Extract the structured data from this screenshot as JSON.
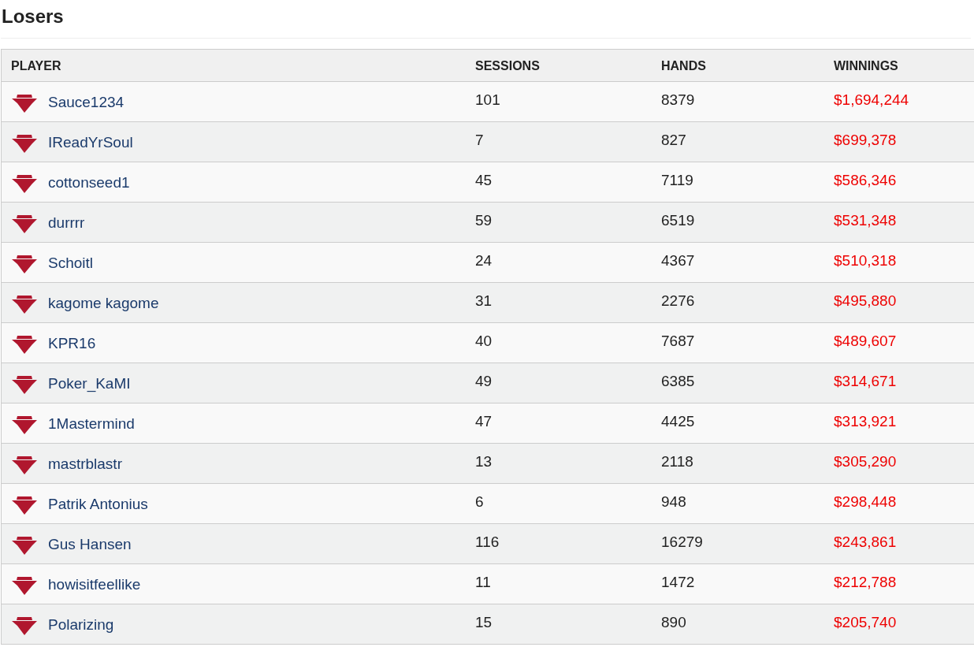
{
  "title": "Losers",
  "table": {
    "columns": [
      "PLAYER",
      "SESSIONS",
      "HANDS",
      "WINNINGS"
    ],
    "rows": [
      {
        "player": "Sauce1234",
        "sessions": "101",
        "hands": "8379",
        "winnings": "$1,694,244"
      },
      {
        "player": "IReadYrSoul",
        "sessions": "7",
        "hands": "827",
        "winnings": "$699,378"
      },
      {
        "player": "cottonseed1",
        "sessions": "45",
        "hands": "7119",
        "winnings": "$586,346"
      },
      {
        "player": "durrrr",
        "sessions": "59",
        "hands": "6519",
        "winnings": "$531,348"
      },
      {
        "player": "Schoitl",
        "sessions": "24",
        "hands": "4367",
        "winnings": "$510,318"
      },
      {
        "player": "kagome kagome",
        "sessions": "31",
        "hands": "2276",
        "winnings": "$495,880"
      },
      {
        "player": "KPR16",
        "sessions": "40",
        "hands": "7687",
        "winnings": "$489,607"
      },
      {
        "player": "Poker_KaMI",
        "sessions": "49",
        "hands": "6385",
        "winnings": "$314,671"
      },
      {
        "player": "1Mastermind",
        "sessions": "47",
        "hands": "4425",
        "winnings": "$313,921"
      },
      {
        "player": "mastrblastr",
        "sessions": "13",
        "hands": "2118",
        "winnings": "$305,290"
      },
      {
        "player": "Patrik Antonius",
        "sessions": "6",
        "hands": "948",
        "winnings": "$298,448"
      },
      {
        "player": "Gus Hansen",
        "sessions": "116",
        "hands": "16279",
        "winnings": "$243,861"
      },
      {
        "player": "howisitfeellike",
        "sessions": "11",
        "hands": "1472",
        "winnings": "$212,788"
      },
      {
        "player": "Polarizing",
        "sessions": "15",
        "hands": "890",
        "winnings": "$205,740"
      }
    ]
  }
}
